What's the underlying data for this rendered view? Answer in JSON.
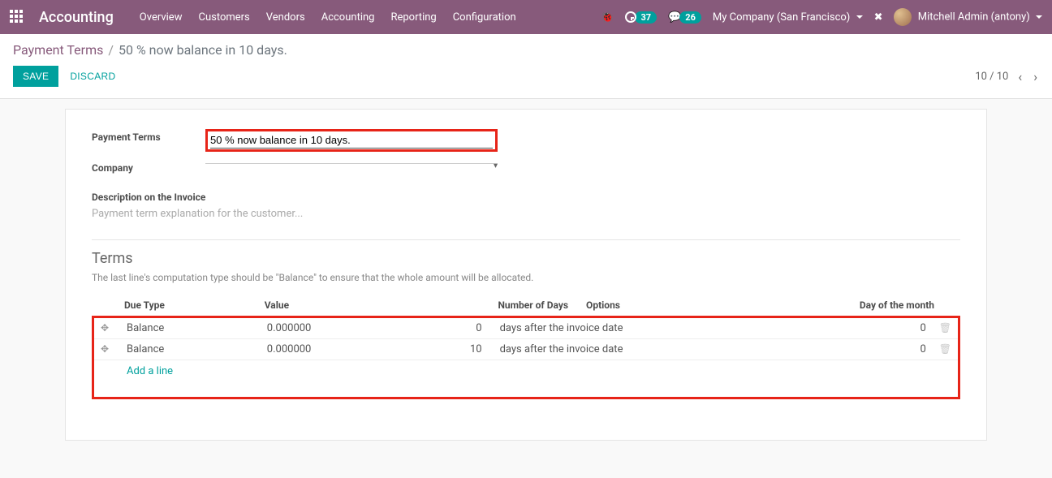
{
  "nav": {
    "app_title": "Accounting",
    "items": [
      "Overview",
      "Customers",
      "Vendors",
      "Accounting",
      "Reporting",
      "Configuration"
    ],
    "activity_count": "37",
    "messages_count": "26",
    "company": "My Company (San Francisco)",
    "user": "Mitchell Admin (antony)"
  },
  "breadcrumb": {
    "parent": "Payment Terms",
    "current": "50 % now balance in 10 days."
  },
  "actions": {
    "save": "SAVE",
    "discard": "DISCARD"
  },
  "pager": {
    "text": "10 / 10"
  },
  "form": {
    "payment_terms_label": "Payment Terms",
    "payment_terms_value": "50 % now balance in 10 days.",
    "company_label": "Company",
    "company_value": "",
    "description_label": "Description on the Invoice",
    "description_placeholder": "Payment term explanation for the customer..."
  },
  "terms": {
    "title": "Terms",
    "help": "The last line's computation type should be \"Balance\" to ensure that the whole amount will be allocated.",
    "columns": {
      "due_type": "Due Type",
      "value": "Value",
      "num_days": "Number of Days",
      "options": "Options",
      "day_of_month": "Day of the month"
    },
    "rows": [
      {
        "due_type": "Balance",
        "value": "0.000000",
        "num_days": "0",
        "options": "days after the invoice date",
        "day_of_month": "0"
      },
      {
        "due_type": "Balance",
        "value": "0.000000",
        "num_days": "10",
        "options": "days after the invoice date",
        "day_of_month": "0"
      }
    ],
    "add_line": "Add a line"
  }
}
